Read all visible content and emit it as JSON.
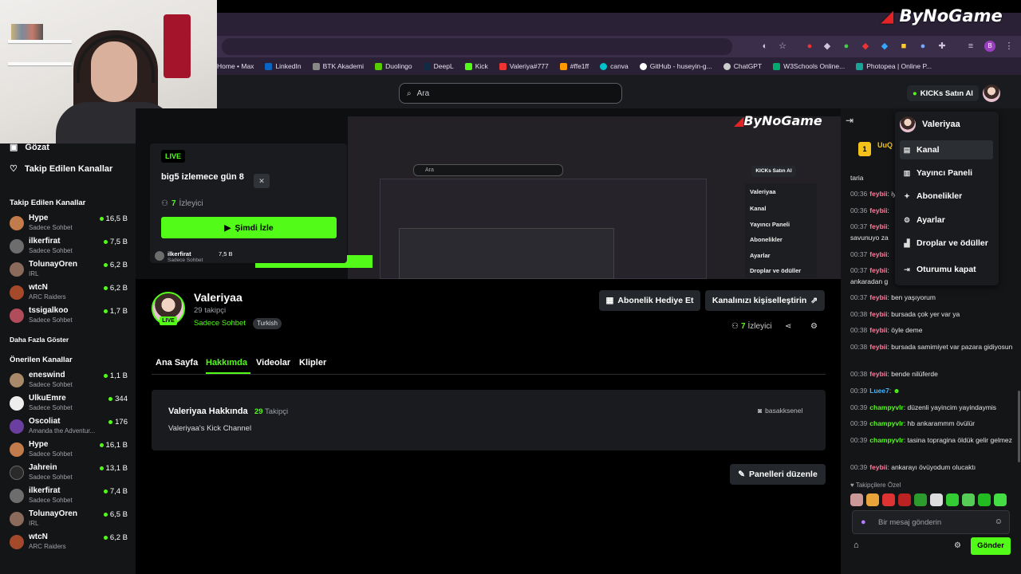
{
  "watermark": {
    "brand_prefix": "By",
    "brand_main": "NoGame"
  },
  "bookmarks": [
    "Home • Max",
    "LinkedIn",
    "BTK Akademi",
    "Duolingo",
    "DeepL",
    "Kick",
    "Valeriya#777",
    "#ffe1ff",
    "canva",
    "GitHub - huseyin-g...",
    "ChatGPT",
    "W3Schools Online...",
    "Photopea | Online P..."
  ],
  "header": {
    "search_placeholder": "Ara",
    "kicks_button": "KICKs Satın Al"
  },
  "sidebar": {
    "browse": "Gözat",
    "following_link": "Takip Edilen Kanallar",
    "following_heading": "Takip Edilen Kanallar",
    "following": [
      {
        "name": "Hype",
        "category": "Sadece Sohbet",
        "viewers": "16,5 B",
        "color": "#c27b4a"
      },
      {
        "name": "ilkerfirat",
        "category": "Sadece Sohbet",
        "viewers": "7,5 B",
        "color": "#6d6d6d"
      },
      {
        "name": "TolunayOren",
        "category": "IRL",
        "viewers": "6,2 B",
        "color": "#8a6a5a"
      },
      {
        "name": "wtcN",
        "category": "ARC Raiders",
        "viewers": "6,2 B",
        "color": "#a44a2a"
      },
      {
        "name": "tssigalkoo",
        "category": "Sadece Sohbet",
        "viewers": "1,7 B",
        "color": "#b14c5a"
      }
    ],
    "show_more": "Daha Fazla Göster",
    "recommended_heading": "Önerilen Kanallar",
    "recommended": [
      {
        "name": "eneswind",
        "category": "Sadece Sohbet",
        "viewers": "1,1 B",
        "color": "#a88a6a"
      },
      {
        "name": "UlkuEmre",
        "category": "Sadece Sohbet",
        "viewers": "344",
        "color": "#eeeeee"
      },
      {
        "name": "Oscoliat",
        "category": "Amanda the Adventur...",
        "viewers": "176",
        "color": "#6b3fa0"
      },
      {
        "name": "Hype",
        "category": "Sadece Sohbet",
        "viewers": "16,1 B",
        "color": "#c27b4a"
      },
      {
        "name": "Jahrein",
        "category": "Sadece Sohbet",
        "viewers": "13,1 B",
        "color": "#2a2a2a"
      },
      {
        "name": "ilkerfirat",
        "category": "Sadece Sohbet",
        "viewers": "7,4 B",
        "color": "#6d6d6d"
      },
      {
        "name": "TolunayOren",
        "category": "IRL",
        "viewers": "6,5 B",
        "color": "#8a6a5a"
      },
      {
        "name": "wtcN",
        "category": "ARC Raiders",
        "viewers": "6,2 B",
        "color": "#a44a2a"
      }
    ]
  },
  "preview": {
    "live": "LIVE",
    "title": "big5 izlemece gün 8",
    "viewers": "7",
    "viewers_label": "İzleyici",
    "watch_button": "Şimdi İzle",
    "mini_row_name": "ilkerfirat",
    "mini_row_cat": "Sadece Sohbet",
    "mini_row_count": "7,5 B"
  },
  "video_inner": {
    "search": "Ara",
    "kicks": "KICKs Satın Al",
    "menu": [
      "Valeriyaa",
      "Kanal",
      "Yayıncı Paneli",
      "Abonelikler",
      "Ayarlar",
      "Droplar ve ödüller"
    ]
  },
  "channel": {
    "name": "Valeriyaa",
    "followers": "29 takipçi",
    "live": "LIVE",
    "category": "Sadece Sohbet",
    "tag": "Turkish",
    "gift_button": "Abonelik Hediye Et",
    "customize_button": "Kanalınızı kişiselleştirin",
    "viewers": "7",
    "viewers_label": "İzleyici"
  },
  "tabs": [
    "Ana Sayfa",
    "Hakkımda",
    "Videolar",
    "Klipler"
  ],
  "about": {
    "title": "Valeriyaa Hakkında",
    "followers": "29",
    "followers_label": "Takipçi",
    "description": "Valeriyaa's Kick Channel",
    "social": "basakksenel",
    "edit_button": "Panelleri düzenle"
  },
  "chat": {
    "pinned_name": "UuQ",
    "pinned_badge": "1",
    "messages": [
      {
        "time": "",
        "user": "",
        "text": "taria",
        "cls": ""
      },
      {
        "time": "00:36",
        "user": "feybii",
        "text": "iyi",
        "cls": ""
      },
      {
        "time": "00:36",
        "user": "feybii",
        "text": "",
        "cls": ""
      },
      {
        "time": "00:37",
        "user": "feybii",
        "text": "savunuyo za",
        "cls": ""
      },
      {
        "time": "00:37",
        "user": "feybii",
        "text": "",
        "cls": ""
      },
      {
        "time": "00:37",
        "user": "feybii",
        "text": "",
        "cls": ""
      },
      {
        "time": "00:37",
        "user": "feybii",
        "text": "ankaradan g",
        "cls": ""
      },
      {
        "time": "00:37",
        "user": "feybii",
        "text": "ben yaşıyorum",
        "cls": ""
      },
      {
        "time": "00:38",
        "user": "feybii",
        "text": "bursada çok yer var ya",
        "cls": ""
      },
      {
        "time": "00:38",
        "user": "feybii",
        "text": "öyle deme",
        "cls": ""
      },
      {
        "time": "00:38",
        "user": "feybii",
        "text": "bursada samimiyet var pazara gidiyosun",
        "cls": ""
      },
      {
        "time": "00:38",
        "user": "feybii",
        "text": "bende nilüferde",
        "cls": ""
      },
      {
        "time": "00:39",
        "user": "Luee7",
        "text": "",
        "cls": "blue"
      },
      {
        "time": "00:39",
        "user": "champyvlr",
        "text": "düzenli yayincim yayindaymis",
        "cls": "green"
      },
      {
        "time": "00:39",
        "user": "champyvlr",
        "text": "hb ankarammm övülür",
        "cls": "green"
      },
      {
        "time": "00:39",
        "user": "champyvlr",
        "text": "tasina topragina öldük gelir gelmez",
        "cls": "green"
      },
      {
        "time": "00:39",
        "user": "feybii",
        "text": "ankarayı övüyodum olucaktı",
        "cls": ""
      }
    ],
    "emote_label": "Takipçilere Özel",
    "input_placeholder": "Bir mesaj gönderin",
    "send_button": "Gönder"
  },
  "dropdown": {
    "user": "Valeriyaa",
    "items": [
      "Kanal",
      "Yayıncı Paneli",
      "Abonelikler",
      "Ayarlar",
      "Droplar ve ödüller",
      "Oturumu kapat"
    ]
  },
  "colors": {
    "accent": "#53fc18",
    "background": "#0b0c0d",
    "panel": "#191b1f"
  }
}
